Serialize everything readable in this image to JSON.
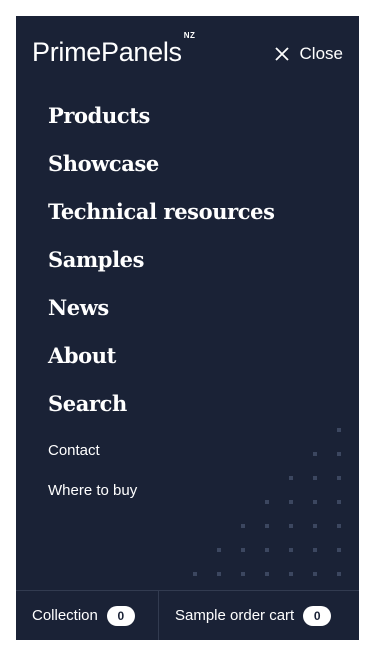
{
  "brand": {
    "name": "PrimePanels",
    "superscript": "NZ"
  },
  "header": {
    "close_label": "Close"
  },
  "nav": {
    "primary": [
      "Products",
      "Showcase",
      "Technical resources",
      "Samples",
      "News",
      "About",
      "Search"
    ],
    "secondary": [
      "Contact",
      "Where to buy"
    ]
  },
  "footer": {
    "collection_label": "Collection",
    "collection_count": "0",
    "cart_label": "Sample order cart",
    "cart_count": "0"
  },
  "colors": {
    "panel_background": "#1a2236",
    "text": "#ffffff",
    "dot_pattern": "#3c4760"
  }
}
